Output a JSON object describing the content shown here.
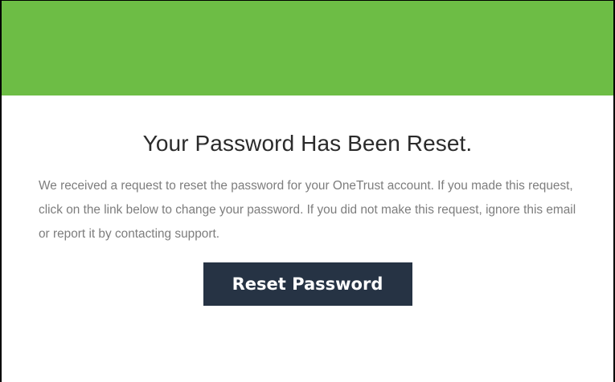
{
  "email": {
    "title": "Your Password Has Been Reset.",
    "body": "We received a request to reset the password for your OneTrust account. If you made this request, click on the link below to change your password. If you did not make this request, ignore this email or report it by contacting support.",
    "button_label": "Reset Password"
  },
  "colors": {
    "banner": "#6dbd45",
    "button": "#263344",
    "body_text": "#7d7d7d",
    "title_text": "#2b2b2b"
  }
}
